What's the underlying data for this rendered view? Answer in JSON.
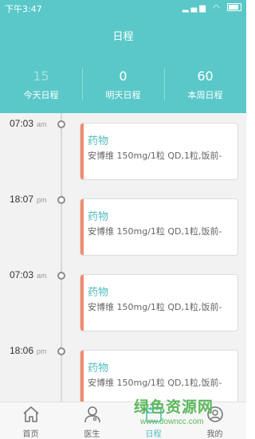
{
  "status_bar": {
    "time": "下午3:47"
  },
  "header": {
    "title": "日程"
  },
  "stats": [
    {
      "value": "15",
      "label": "今天日程"
    },
    {
      "value": "0",
      "label": "明天日程"
    },
    {
      "value": "60",
      "label": "本周日程"
    }
  ],
  "schedule": [
    {
      "time": "07:03",
      "ampm": "am",
      "title": "药物",
      "detail": "安博维 150mg/1粒 QD,1粒,饭前-"
    },
    {
      "time": "18:07",
      "ampm": "pm",
      "title": "药物",
      "detail": "安博维 150mg/1粒 QD,1粒,饭前-"
    },
    {
      "time": "07:03",
      "ampm": "am",
      "title": "药物",
      "detail": "安博维 150mg/1粒 QD,1粒,饭前-"
    },
    {
      "time": "18:06",
      "ampm": "pm",
      "title": "药物",
      "detail": "安博维 150mg/1粒 QD,1粒,饭前-"
    }
  ],
  "tabs": [
    {
      "label": "首页",
      "icon": "home-icon"
    },
    {
      "label": "医生",
      "icon": "doctor-icon"
    },
    {
      "label": "日程",
      "icon": "calendar-icon",
      "active": true
    },
    {
      "label": "我的",
      "icon": "profile-icon"
    }
  ],
  "watermark": {
    "title": "绿色资源网",
    "url": "www.downcc.com"
  },
  "colors": {
    "primary": "#5ac8c8",
    "accent": "#f08c6e",
    "card_title": "#4fbcbc"
  }
}
